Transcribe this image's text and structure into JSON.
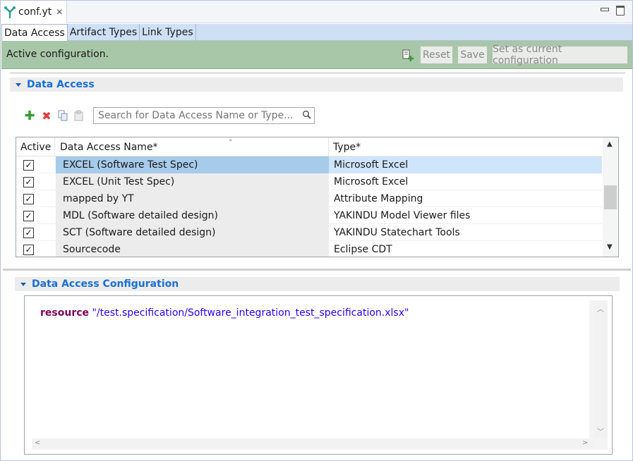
{
  "editor_tab": {
    "title": "conf.yt",
    "close": "✕"
  },
  "page_tabs": [
    {
      "label": "Data Access",
      "active": true
    },
    {
      "label": "Artifact Types",
      "active": false
    },
    {
      "label": "Link Types",
      "active": false
    }
  ],
  "status": {
    "text": "Active configuration.",
    "reset_label": "Reset",
    "save_label": "Save",
    "set_current_label": "Set as current configuration",
    "bg_color": "#a8c7a8"
  },
  "data_access_section": {
    "title": "Data Access",
    "search_placeholder": "Search for Data Access Name or Type...",
    "columns": {
      "active": "Active",
      "name": "Data Access Name*",
      "type": "Type*"
    },
    "rows": [
      {
        "active": true,
        "name": "EXCEL (Software Test Spec)",
        "type": "Microsoft Excel",
        "selected": true
      },
      {
        "active": true,
        "name": "EXCEL (Unit Test Spec)",
        "type": "Microsoft Excel",
        "selected": false
      },
      {
        "active": true,
        "name": "mapped by YT",
        "type": "Attribute Mapping",
        "selected": false
      },
      {
        "active": true,
        "name": "MDL (Software detailed design)",
        "type": "YAKINDU Model Viewer files",
        "selected": false
      },
      {
        "active": true,
        "name": "SCT (Software detailed design)",
        "type": "YAKINDU Statechart Tools",
        "selected": false
      },
      {
        "active": true,
        "name": "Sourcecode",
        "type": "Eclipse CDT",
        "selected": false
      }
    ]
  },
  "config_section": {
    "title": "Data Access Configuration",
    "keyword": "resource",
    "value": "\"/test.specification/Software_integration_test_specification.xlsx\""
  },
  "icons": {
    "app": "yakindu-traceability-icon",
    "add": "add-icon",
    "delete": "delete-icon",
    "copy": "copy-icon",
    "paste": "paste-icon",
    "search": "search-icon",
    "add_config": "add-configuration-icon"
  },
  "colors": {
    "accent": "#1a6fd0",
    "keyword": "#7f0055",
    "string": "#2a00ff"
  }
}
